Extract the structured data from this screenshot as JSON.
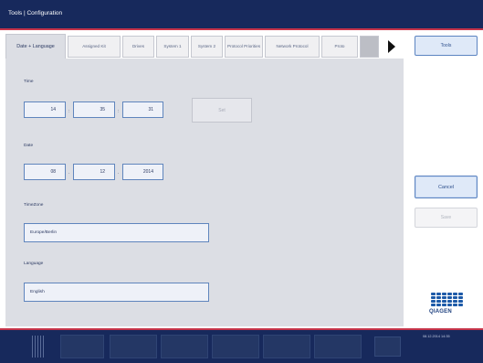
{
  "header": {
    "title": "Tools | Configuration"
  },
  "tabs": [
    {
      "label": "Date + Language",
      "active": true
    },
    {
      "label": "Assigned Kit",
      "active": false
    },
    {
      "label": "Drives",
      "active": false
    },
    {
      "label": "System 1",
      "active": false
    },
    {
      "label": "System 2",
      "active": false
    },
    {
      "label": "Protocol Priorities",
      "active": false
    },
    {
      "label": "Network Protocol",
      "active": false
    },
    {
      "label": "Proto",
      "active": false
    },
    {
      "label": "",
      "active": false
    }
  ],
  "tab_arrow_icon": "right-triangle-icon",
  "form": {
    "time_label": "Time",
    "time": {
      "hour": "14",
      "minute": "35",
      "second": "31"
    },
    "time_sep": ":",
    "set_button": "Set",
    "date_label": "Date",
    "date": {
      "day": "08",
      "month": "12",
      "year": "2014"
    },
    "date_sep": ".",
    "timezone_label": "TimeZone",
    "timezone_value": "Europe/Berlin",
    "language_label": "Language",
    "language_value": "English"
  },
  "sidebar": {
    "tools_button": "Tools",
    "cancel_button": "Cancel",
    "save_button": "Save"
  },
  "logo": {
    "text": "QIAGEN"
  },
  "footer": {
    "cells": [
      "",
      "",
      "",
      "",
      "",
      ""
    ],
    "status_rows": [
      {
        "k": "",
        "v": "08.12.2014 14:35"
      },
      {
        "k": "",
        "v": ""
      },
      {
        "k": "",
        "v": ""
      }
    ]
  },
  "colors": {
    "header_bg": "#17295c",
    "accent_red": "#c5344a",
    "panel_bg": "#dcdee4",
    "field_border": "#5f85bd",
    "button_blue": "#5c84c1"
  }
}
